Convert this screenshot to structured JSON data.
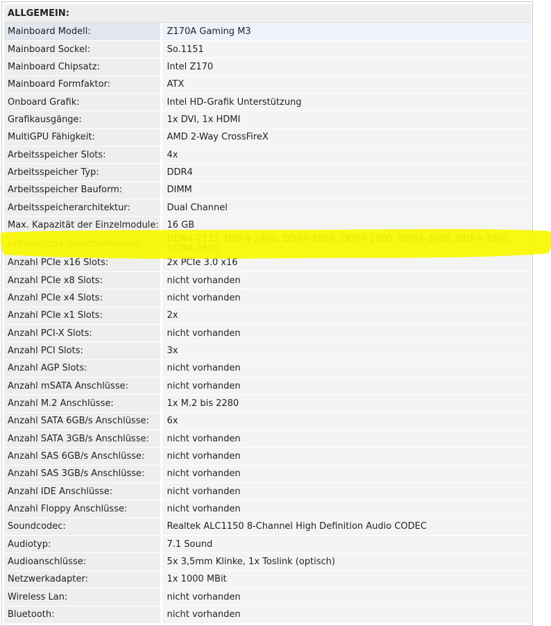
{
  "section": {
    "title": "ALLGEMEIN:"
  },
  "rows": [
    {
      "label": "Mainboard Modell:",
      "value": "Z170A Gaming M3"
    },
    {
      "label": "Mainboard Sockel:",
      "value": "So.1151"
    },
    {
      "label": "Mainboard Chipsatz:",
      "value": "Intel Z170"
    },
    {
      "label": "Mainboard Formfaktor:",
      "value": "ATX"
    },
    {
      "label": "Onboard Grafik:",
      "value": "Intel HD-Grafik Unterstützung"
    },
    {
      "label": "Grafikausgänge:",
      "value": "1x DVI, 1x HDMI"
    },
    {
      "label": "MultiGPU Fähigkeit:",
      "value": "AMD 2-Way CrossFireX"
    },
    {
      "label": "Arbeitsspeicher Slots:",
      "value": "4x"
    },
    {
      "label": "Arbeitsspeicher Typ:",
      "value": "DDR4"
    },
    {
      "label": "Arbeitsspeicher Bauform:",
      "value": "DIMM"
    },
    {
      "label": "Arbeitsspeicherarchitektur:",
      "value": "Dual Channel"
    },
    {
      "label": "Max. Kapazität der Einzelmodule:",
      "value": "16 GB"
    },
    {
      "label": "Unterstützte Speichermodule:",
      "value": "DDR4-2133, DDR4-2400, DDR4-2600, DDR4-2800, DDR4-3000, DDR4-3200, DDR4-3600"
    },
    {
      "label": "Anzahl PCIe x16 Slots:",
      "value": "2x PCIe 3.0 x16"
    },
    {
      "label": "Anzahl PCIe x8 Slots:",
      "value": "nicht vorhanden"
    },
    {
      "label": "Anzahl PCIe x4 Slots:",
      "value": "nicht vorhanden"
    },
    {
      "label": "Anzahl PCIe x1 Slots:",
      "value": "2x"
    },
    {
      "label": "Anzahl PCI-X Slots:",
      "value": "nicht vorhanden"
    },
    {
      "label": "Anzahl PCI Slots:",
      "value": "3x"
    },
    {
      "label": "Anzahl AGP Slots:",
      "value": "nicht vorhanden"
    },
    {
      "label": "Anzahl mSATA Anschlüsse:",
      "value": "nicht vorhanden"
    },
    {
      "label": "Anzahl M.2 Anschlüsse:",
      "value": "1x M.2 bis 2280"
    },
    {
      "label": "Anzahl SATA 6GB/s Anschlüsse:",
      "value": "6x"
    },
    {
      "label": "Anzahl SATA 3GB/s Anschlüsse:",
      "value": "nicht vorhanden"
    },
    {
      "label": "Anzahl SAS 6GB/s Anschlüsse:",
      "value": "nicht vorhanden"
    },
    {
      "label": "Anzahl SAS 3GB/s Anschlüsse:",
      "value": "nicht vorhanden"
    },
    {
      "label": "Anzahl IDE Anschlüsse:",
      "value": "nicht vorhanden"
    },
    {
      "label": "Anzahl Floppy Anschlüsse:",
      "value": "nicht vorhanden"
    },
    {
      "label": "Soundcodec:",
      "value": "Realtek ALC1150 8-Channel High Definition Audio CODEC"
    },
    {
      "label": "Audiotyp:",
      "value": "7.1 Sound"
    },
    {
      "label": "Audioanschlüsse:",
      "value": "5x 3,5mm Klinke, 1x Toslink (optisch)"
    },
    {
      "label": "Netzwerkadapter:",
      "value": "1x 1000 MBit"
    },
    {
      "label": "Wireless Lan:",
      "value": "nicht vorhanden"
    },
    {
      "label": "Bluetooth:",
      "value": "nicht vorhanden"
    }
  ],
  "highlight": {
    "color": "#f7f700"
  },
  "colors": {
    "label_bg": "#eeeeee",
    "value_bg": "#f4f4f4",
    "first_row_label_bg": "#e2e6ef",
    "first_row_value_bg": "#eff2fa"
  }
}
